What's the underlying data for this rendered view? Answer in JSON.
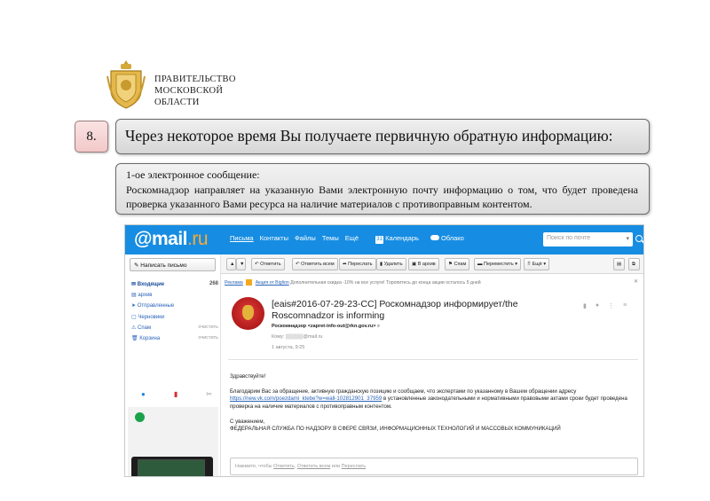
{
  "header": {
    "org_lines": [
      "ПРАВИТЕЛЬСТВО",
      "МОСКОВСКОЙ",
      "ОБЛАСТИ"
    ]
  },
  "step": {
    "number": "8.",
    "title": "Через некоторое время Вы получаете первичную обратную информацию:"
  },
  "note": {
    "line1": "1-ое электронное сообщение:",
    "line2": "Роскомнадзор направляет на указанную Вами электронную почту информацию о том, что будет проведена проверка указанного Вами ресурса на наличие материалов с противоправным контентом."
  },
  "mail": {
    "brand": "@mail",
    "brand_suffix": ".ru",
    "nav": [
      "Письма",
      "Контакты",
      "Файлы",
      "Темы",
      "Ещё"
    ],
    "calendar": "Календарь",
    "cloud": "Облако",
    "search_placeholder": "Поиск по почте",
    "compose": "Написать письмо",
    "folders": [
      {
        "label": "Входящие",
        "count": "268"
      },
      {
        "label": "архив",
        "count": ""
      },
      {
        "label": "Отправленные",
        "count": ""
      },
      {
        "label": "Черновики",
        "count": ""
      },
      {
        "label": "Спам",
        "action": "очистить"
      },
      {
        "label": "Корзина",
        "action": "очистить"
      }
    ],
    "toolbar": {
      "reply": "Ответить",
      "reply_all": "Ответить всем",
      "forward": "Переслать",
      "delete": "Удалить",
      "archive": "В архив",
      "spam": "Спам",
      "move": "Переместить",
      "more": "Ещё"
    },
    "ad": {
      "label": "Реклама",
      "link": "Акция от Biglion",
      "text": "Дополнительная скидка -10% на все услуги! Торопитесь до конца акции осталось 5 дней"
    },
    "message": {
      "subject": "[eais#2016-07-29-23-CC] Роскомнадзор информирует/the Roscomnadzor is informing",
      "from": "Роскомнадзор <zapret-info-out@rkn.gov.ru>",
      "to": "Кому: ▒▒▒▒▒@mail.ru",
      "date": "1 августа, 9:25",
      "greeting": "Здравствуйте!",
      "body_pre": "Благодарим Вас за обращение, активную гражданскую позицию и сообщаем, что экспертами по указанному в Вашем обращении адресу ",
      "body_link": "https://new.vk.com/poezdami_ktebe?w=wall-102812901_37959",
      "body_post": " в установленные законодательными и нормативными правовыми актами сроки будет проведена проверка на наличие материалов с противоправным контентом.",
      "sign1": "С уважением,",
      "sign2": "ФЕДЕРАЛЬНАЯ СЛУЖБА ПО НАДЗОРУ В СФЕРЕ СВЯЗИ, ИНФОРМАЦИОННЫХ ТЕХНОЛОГИЙ И МАССОВЫХ КОММУНИКАЦИЙ"
    },
    "reply_box": {
      "pre": "Нажмите, чтобы ",
      "reply": "Ответить",
      "sep1": ", ",
      "reply_all": "Ответить всем",
      "sep2": " или ",
      "forward": "Переслать"
    }
  }
}
